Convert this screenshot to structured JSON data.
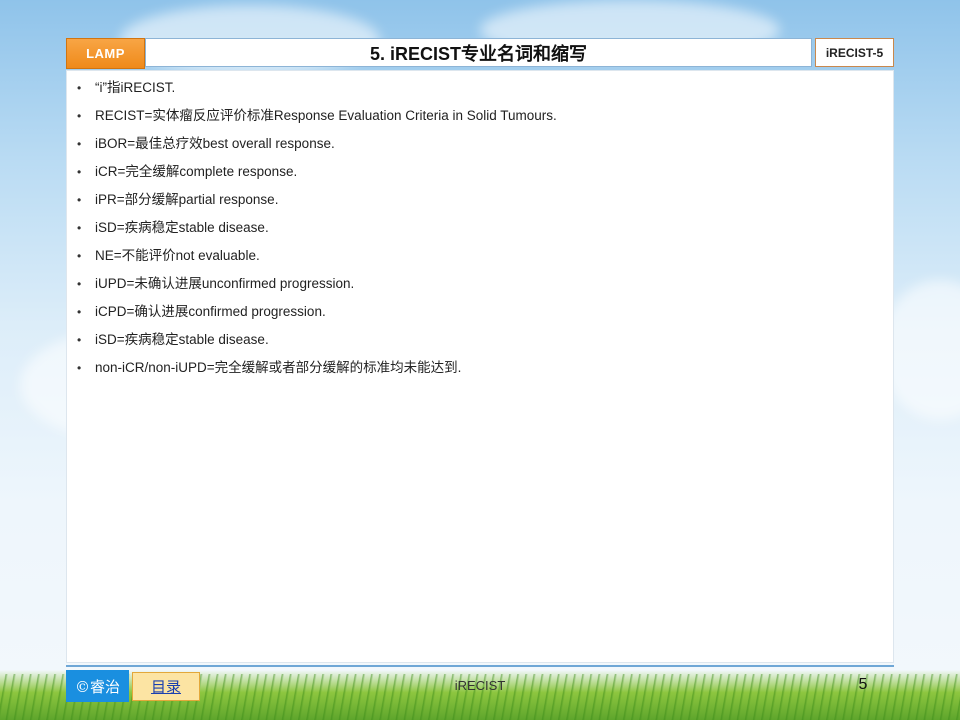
{
  "header": {
    "brand": "LAMP",
    "title": "5. iRECIST专业名词和缩写",
    "tag": "iRECIST-5"
  },
  "items": [
    "“i”指iRECIST.",
    "RECIST=实体瘤反应评价标准Response Evaluation Criteria in Solid Tumours.",
    "iBOR=最佳总疗效best overall response.",
    "iCR=完全缓解complete response.",
    "iPR=部分缓解partial response.",
    "iSD=疾病稳定stable disease.",
    "NE=不能评价not evaluable.",
    "iUPD=未确认进展unconfirmed  progression.",
    "iCPD=确认进展confirmed  progression.",
    "iSD=疾病稳定stable disease.",
    "non-iCR/non-iUPD=完全缓解或者部分缓解的标准均未能达到."
  ],
  "bullet_char": "•",
  "footer": {
    "logo": "©睿治",
    "toc_label": "目录",
    "center_text": "iRECIST",
    "page_number": "5"
  },
  "colors": {
    "brand_orange": "#ef8a1a",
    "title_border": "#8db4d6",
    "footer_line": "#6fa7d6",
    "logo_blue": "#1a8fe0",
    "toc_bg": "#fce4a3"
  }
}
